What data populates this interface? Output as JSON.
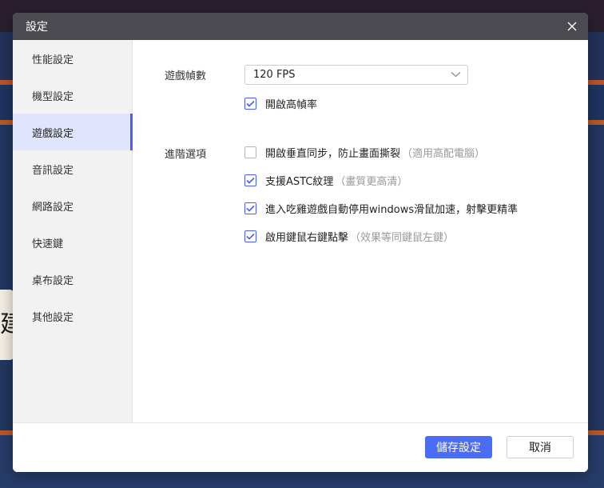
{
  "dialog": {
    "title": "設定"
  },
  "sidebar": {
    "items": [
      {
        "label": "性能設定",
        "active": false
      },
      {
        "label": "機型設定",
        "active": false
      },
      {
        "label": "遊戲設定",
        "active": true
      },
      {
        "label": "音訊設定",
        "active": false
      },
      {
        "label": "網路設定",
        "active": false
      },
      {
        "label": "快速鍵",
        "active": false
      },
      {
        "label": "桌布設定",
        "active": false
      },
      {
        "label": "其他設定",
        "active": false
      }
    ]
  },
  "game": {
    "fps_label": "遊戲幀數",
    "fps_value": "120 FPS",
    "high_fps": {
      "label": "開啟高幀率",
      "checked": true
    },
    "advanced_label": "進階選項",
    "options": [
      {
        "label": "開啟垂直同步，防止畫面撕裂",
        "hint": "（適用高配電腦）",
        "checked": false
      },
      {
        "label": "支援ASTC紋理",
        "hint": "（畫質更高清）",
        "checked": true
      },
      {
        "label": "進入吃雞遊戲自動停用windows滑鼠加速，射擊更精準",
        "hint": "",
        "checked": true
      },
      {
        "label": "啟用鍵鼠右鍵點擊",
        "hint": "（效果等同鍵鼠左鍵）",
        "checked": true
      }
    ]
  },
  "footer": {
    "save_label": "儲存設定",
    "cancel_label": "取消"
  },
  "background": {
    "tile_glyph": "建"
  },
  "colors": {
    "accent": "#4b6cf5",
    "titlebar": "#4a4a50",
    "active_item_bg": "#e0e4fc"
  }
}
